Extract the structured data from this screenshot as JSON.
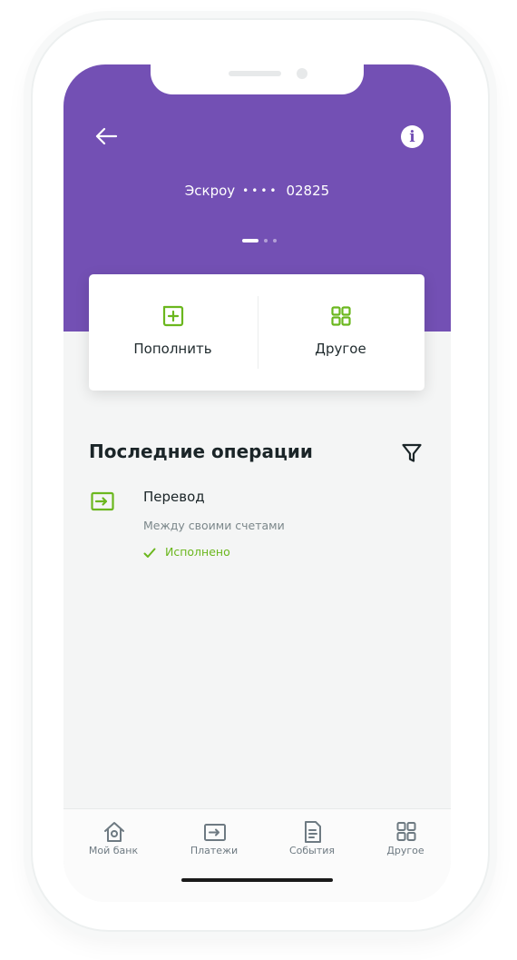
{
  "header": {
    "account_name": "Эскроу",
    "account_mask": "••••",
    "account_number": "02825"
  },
  "actions": [
    {
      "label": "Пополнить",
      "icon": "plus-square-icon"
    },
    {
      "label": "Другое",
      "icon": "grid-icon"
    }
  ],
  "operations": {
    "title": "Последние операции",
    "items": [
      {
        "title": "Перевод",
        "subtitle": "Между своими счетами",
        "status": "Исполнено",
        "icon": "transfer-icon"
      }
    ]
  },
  "tabbar": [
    {
      "label": "Мой банк",
      "icon": "home-icon"
    },
    {
      "label": "Платежи",
      "icon": "payments-icon"
    },
    {
      "label": "События",
      "icon": "document-icon"
    },
    {
      "label": "Другое",
      "icon": "grid-icon"
    }
  ],
  "colors": {
    "header_bg": "#7350b4",
    "accent_green": "#6bb71e",
    "background": "#f4f5f5"
  }
}
